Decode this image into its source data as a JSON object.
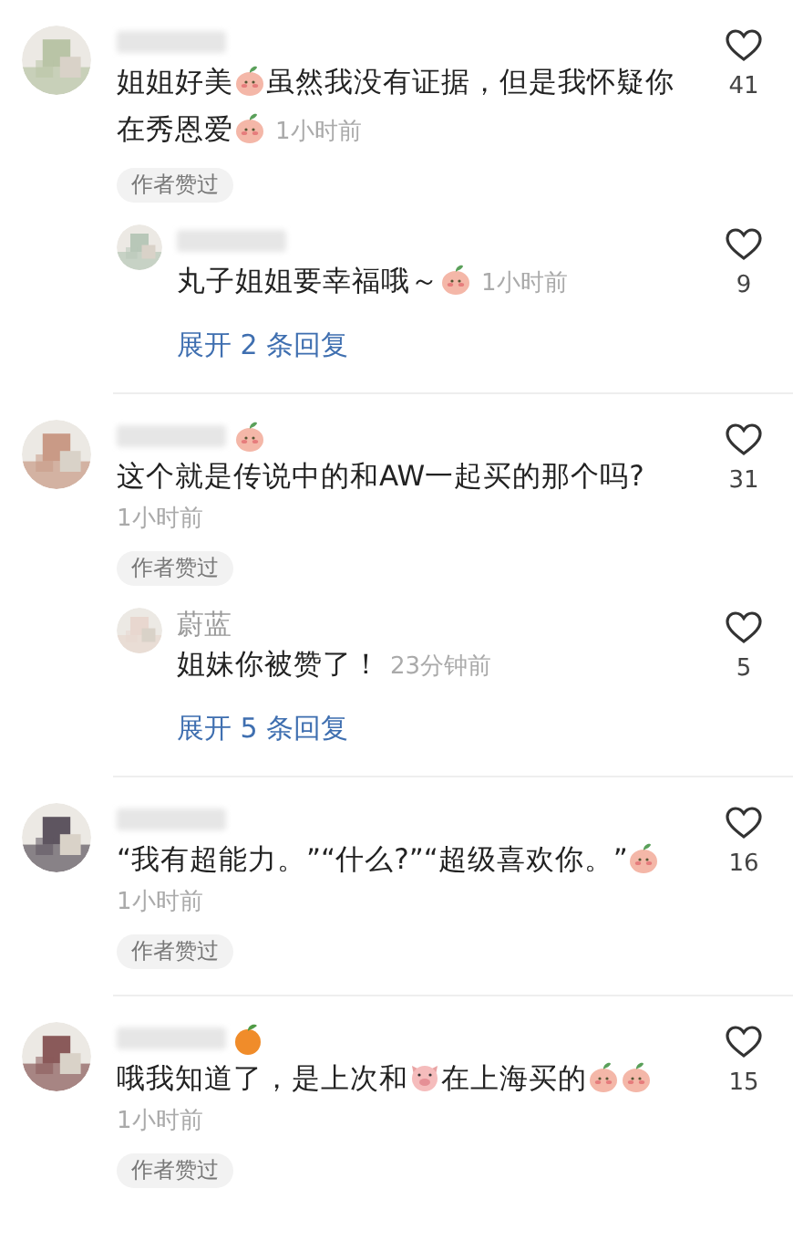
{
  "comments": [
    {
      "author": {
        "kind": "blurred"
      },
      "body": [
        {
          "kind": "text",
          "text": "姐姐好美"
        },
        {
          "kind": "peach"
        },
        {
          "kind": "text",
          "text": "虽然我没有证据，但是我怀疑你在秀恩爱"
        },
        {
          "kind": "peach"
        }
      ],
      "time": "1小时前",
      "badge": "作者赞过",
      "likes": "41",
      "replies": [
        {
          "author": {
            "kind": "blurred"
          },
          "body": [
            {
              "kind": "text",
              "text": "丸子姐姐要幸福哦～"
            },
            {
              "kind": "peach"
            }
          ],
          "time": "1小时前",
          "likes": "9"
        }
      ],
      "expand": "展开 2 条回复"
    },
    {
      "author": {
        "kind": "blurred_sticker"
      },
      "body": [
        {
          "kind": "text",
          "text": "这个就是传说中的和AW一起买的那个吗?"
        }
      ],
      "time": "1小时前",
      "badge": "作者赞过",
      "likes": "31",
      "replies": [
        {
          "author": {
            "kind": "name",
            "name": "蔚蓝"
          },
          "body": [
            {
              "kind": "text",
              "text": "姐妹你被赞了！"
            }
          ],
          "time": "23分钟前",
          "likes": "5"
        }
      ],
      "expand": "展开 5 条回复"
    },
    {
      "author": {
        "kind": "blurred"
      },
      "body": [
        {
          "kind": "text",
          "text": "“我有超能力。”“什么?”“超级喜欢你。”"
        },
        {
          "kind": "peach"
        }
      ],
      "time": "1小时前",
      "badge": "作者赞过",
      "likes": "16"
    },
    {
      "author": {
        "kind": "blurred_fruit"
      },
      "body": [
        {
          "kind": "text",
          "text": "哦我知道了，是上次和"
        },
        {
          "kind": "pig"
        },
        {
          "kind": "text",
          "text": "在上海买的"
        },
        {
          "kind": "peach"
        },
        {
          "kind": "peach"
        }
      ],
      "time": "1小时前",
      "badge": "作者赞过",
      "likes": "15"
    }
  ]
}
